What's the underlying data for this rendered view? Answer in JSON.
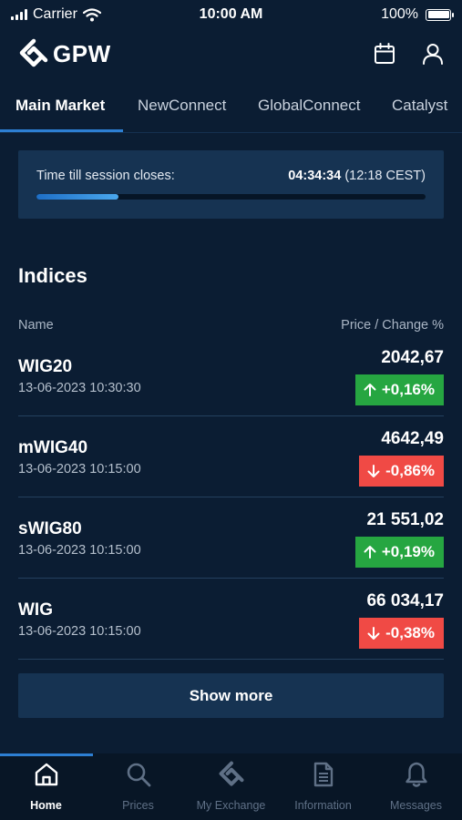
{
  "status_bar": {
    "carrier": "Carrier",
    "time": "10:00 AM",
    "battery": "100%"
  },
  "header": {
    "logo_text": "GPW",
    "icons": [
      "calendar-icon",
      "user-icon"
    ]
  },
  "tabs": [
    {
      "label": "Main Market",
      "active": true
    },
    {
      "label": "NewConnect",
      "active": false
    },
    {
      "label": "GlobalConnect",
      "active": false
    },
    {
      "label": "Catalyst",
      "active": false
    }
  ],
  "session": {
    "label": "Time till session closes:",
    "countdown": "04:34:34",
    "close_time": "(12:18 CEST)",
    "progress": 0.21
  },
  "indices": {
    "title": "Indices",
    "col_name": "Name",
    "col_price": "Price / Change %",
    "rows": [
      {
        "name": "WIG20",
        "datetime": "13-06-2023 10:30:30",
        "price": "2042,67",
        "change": "+0,16%",
        "direction": "up"
      },
      {
        "name": "mWIG40",
        "datetime": "13-06-2023 10:15:00",
        "price": "4642,49",
        "change": "-0,86%",
        "direction": "down"
      },
      {
        "name": "sWIG80",
        "datetime": "13-06-2023 10:15:00",
        "price": "21 551,02",
        "change": "+0,19%",
        "direction": "up"
      },
      {
        "name": "WIG",
        "datetime": "13-06-2023 10:15:00",
        "price": "66 034,17",
        "change": "-0,38%",
        "direction": "down"
      }
    ],
    "show_more": "Show more"
  },
  "colors": {
    "background": "#0b1d33",
    "card": "#163352",
    "accent": "#2d7fd3",
    "up": "#26a641",
    "down": "#f04a45"
  },
  "bottom_nav": [
    {
      "label": "Home",
      "icon": "home-icon",
      "active": true
    },
    {
      "label": "Prices",
      "icon": "search-icon",
      "active": false
    },
    {
      "label": "My Exchange",
      "icon": "gpw-logo-icon",
      "active": false
    },
    {
      "label": "Information",
      "icon": "document-icon",
      "active": false
    },
    {
      "label": "Messages",
      "icon": "bell-icon",
      "active": false
    }
  ]
}
